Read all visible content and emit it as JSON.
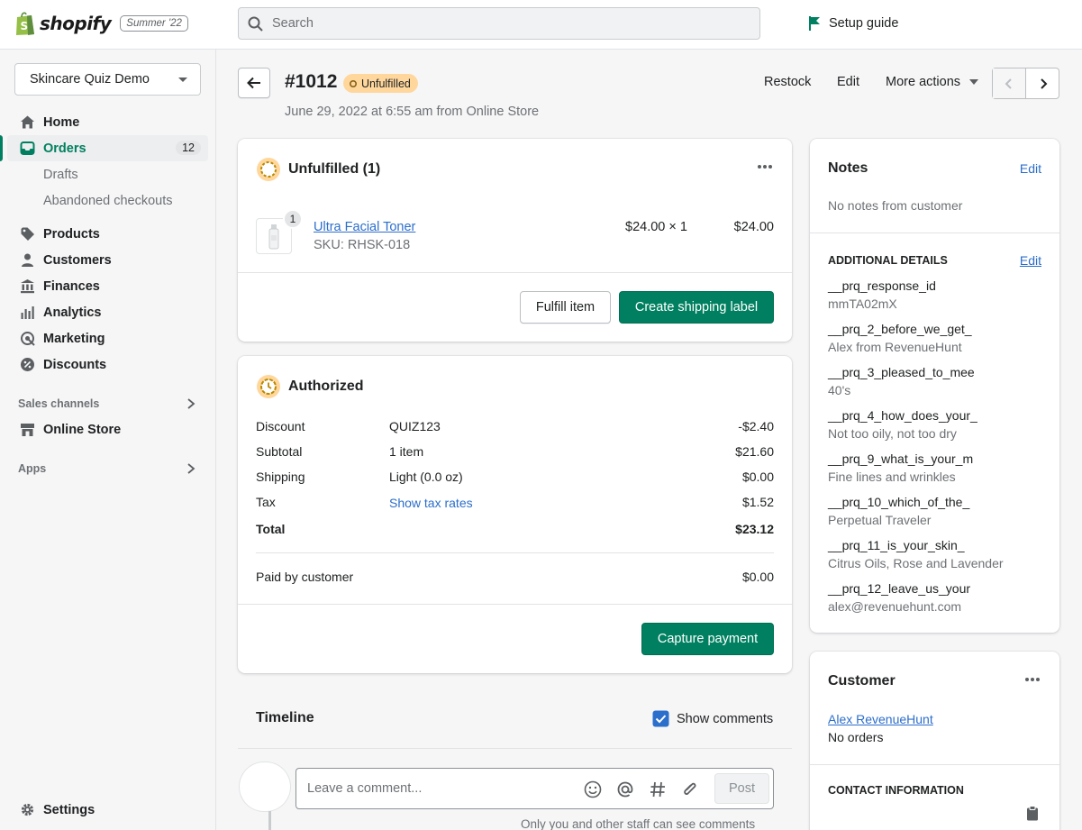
{
  "topbar": {
    "brand": "shopify",
    "edition": "Summer '22",
    "search_placeholder": "Search",
    "setup_guide": "Setup guide"
  },
  "sidebar": {
    "store_name": "Skincare Quiz Demo",
    "items": [
      {
        "label": "Home",
        "icon": "home-icon"
      },
      {
        "label": "Orders",
        "icon": "orders-icon",
        "count": "12"
      },
      {
        "label": "Products",
        "icon": "tag-icon"
      },
      {
        "label": "Customers",
        "icon": "person-icon"
      },
      {
        "label": "Finances",
        "icon": "bank-icon"
      },
      {
        "label": "Analytics",
        "icon": "bar-chart-icon"
      },
      {
        "label": "Marketing",
        "icon": "target-icon"
      },
      {
        "label": "Discounts",
        "icon": "discount-icon"
      }
    ],
    "order_subitems": [
      "Drafts",
      "Abandoned checkouts"
    ],
    "sales_channels_heading": "Sales channels",
    "online_store": "Online Store",
    "apps_heading": "Apps",
    "settings": "Settings"
  },
  "header": {
    "order_number": "#1012",
    "status": "Unfulfilled",
    "subtitle": "June 29, 2022 at 6:55 am from Online Store",
    "restock": "Restock",
    "edit": "Edit",
    "more_actions": "More actions"
  },
  "unfulfilled": {
    "title": "Unfulfilled (1)",
    "item": {
      "quantity_badge": "1",
      "name": "Ultra Facial Toner",
      "sku": "SKU: RHSK-018",
      "unit_price": "$24.00 × 1",
      "total": "$24.00"
    },
    "fulfill_button": "Fulfill item",
    "shipping_label_button": "Create shipping label"
  },
  "payment": {
    "title": "Authorized",
    "rows": [
      {
        "label": "Discount",
        "detail": "QUIZ123",
        "amount": "-$2.40"
      },
      {
        "label": "Subtotal",
        "detail": "1 item",
        "amount": "$21.60"
      },
      {
        "label": "Shipping",
        "detail": "Light (0.0 oz)",
        "amount": "$0.00"
      },
      {
        "label": "Tax",
        "detail": "Show tax rates",
        "amount": "$1.52"
      }
    ],
    "total_label": "Total",
    "total_amount": "$23.12",
    "paid_label": "Paid by customer",
    "paid_amount": "$0.00",
    "capture_button": "Capture payment"
  },
  "timeline": {
    "title": "Timeline",
    "show_comments": "Show comments",
    "comment_placeholder": "Leave a comment...",
    "post_button": "Post",
    "hint": "Only you and other staff can see comments"
  },
  "notes": {
    "title": "Notes",
    "edit": "Edit",
    "text": "No notes from customer"
  },
  "additional": {
    "title": "ADDITIONAL DETAILS",
    "edit": "Edit",
    "items": [
      {
        "key": "__prq_response_id",
        "value": "mmTA02mX"
      },
      {
        "key": "__prq_2_before_we_get_",
        "value": "Alex from RevenueHunt"
      },
      {
        "key": "__prq_3_pleased_to_mee",
        "value": "40's"
      },
      {
        "key": "__prq_4_how_does_your_",
        "value": "Not too oily, not too dry"
      },
      {
        "key": "__prq_9_what_is_your_m",
        "value": "Fine lines and wrinkles"
      },
      {
        "key": "__prq_10_which_of_the_",
        "value": "Perpetual Traveler"
      },
      {
        "key": "__prq_11_is_your_skin_",
        "value": "Citrus Oils, Rose and Lavender"
      },
      {
        "key": "__prq_12_leave_us_your",
        "value": "alex@revenuehunt.com"
      }
    ]
  },
  "customer": {
    "title": "Customer",
    "name": "Alex RevenueHunt",
    "orders": "No orders",
    "contact_heading": "CONTACT INFORMATION"
  }
}
